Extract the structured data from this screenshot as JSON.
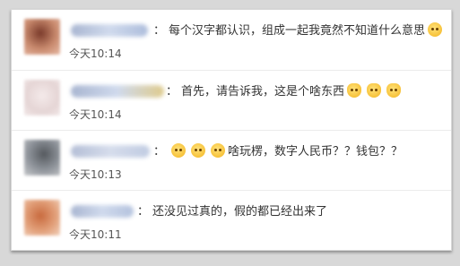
{
  "comments": [
    {
      "text": "每个汉字都认识，组成一起我竟然不知道什么意思",
      "time": "今天10:14",
      "emojis": [
        "sleepy-face-icon"
      ],
      "avatar_color": "#c98a6e"
    },
    {
      "text": "首先，请告诉我，这是个啥东西",
      "time": "今天10:14",
      "emojis": [
        "cat-face-icon",
        "cat-face-icon",
        "cat-face-icon"
      ],
      "avatar_color": "#e8dada"
    },
    {
      "text": "啥玩楞，数字人民币？？钱包？？",
      "time": "今天10:13",
      "emojis": [
        "thinking-face-icon",
        "thinking-face-icon",
        "thinking-face-icon"
      ],
      "avatar_color": "#8a8f96"
    },
    {
      "text": "还没见过真的，假的都已经出来了",
      "time": "今天10:11",
      "emojis": [],
      "avatar_color": "#e2a07a"
    }
  ],
  "colon": "："
}
